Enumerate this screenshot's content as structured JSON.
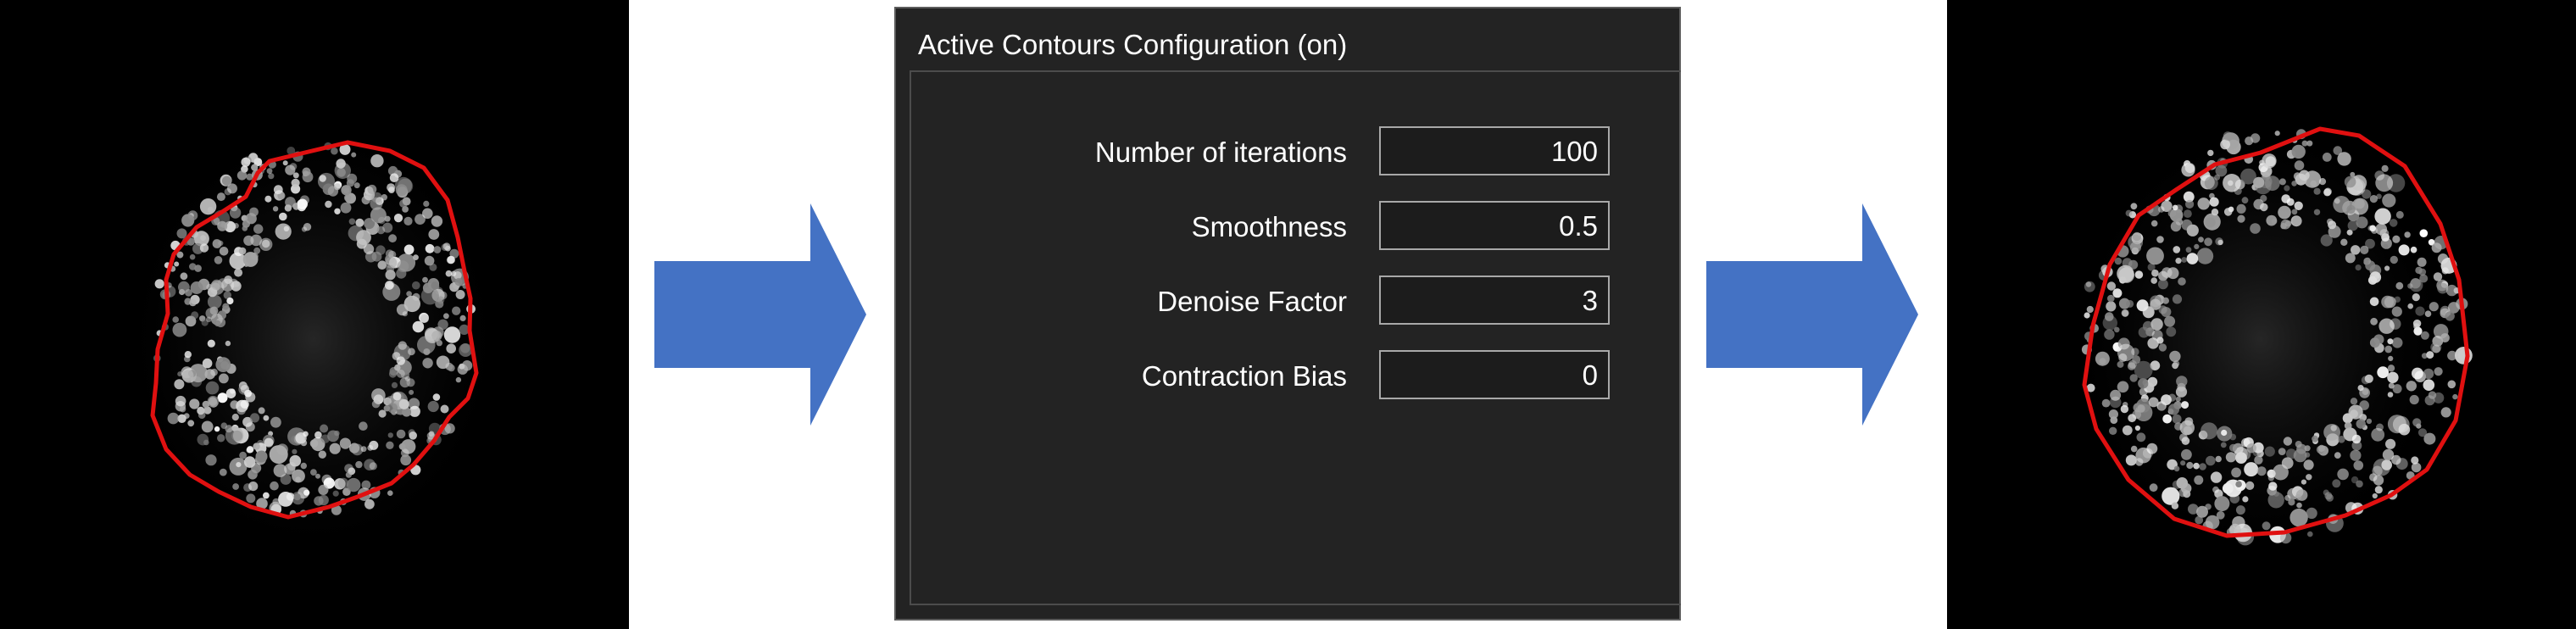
{
  "panel": {
    "title": "Active Contours Configuration (on)",
    "fields": [
      {
        "label": "Number of iterations",
        "value": "100"
      },
      {
        "label": "Smoothness",
        "value": "0.5"
      },
      {
        "label": "Denoise Factor",
        "value": "3"
      },
      {
        "label": "Contraction Bias",
        "value": "0"
      }
    ]
  },
  "colors": {
    "arrow": "#4472c4",
    "contour": "#e01010",
    "panel_bg": "#232323"
  },
  "icons": {
    "arrow_1": "right-arrow-icon",
    "arrow_2": "right-arrow-icon"
  }
}
